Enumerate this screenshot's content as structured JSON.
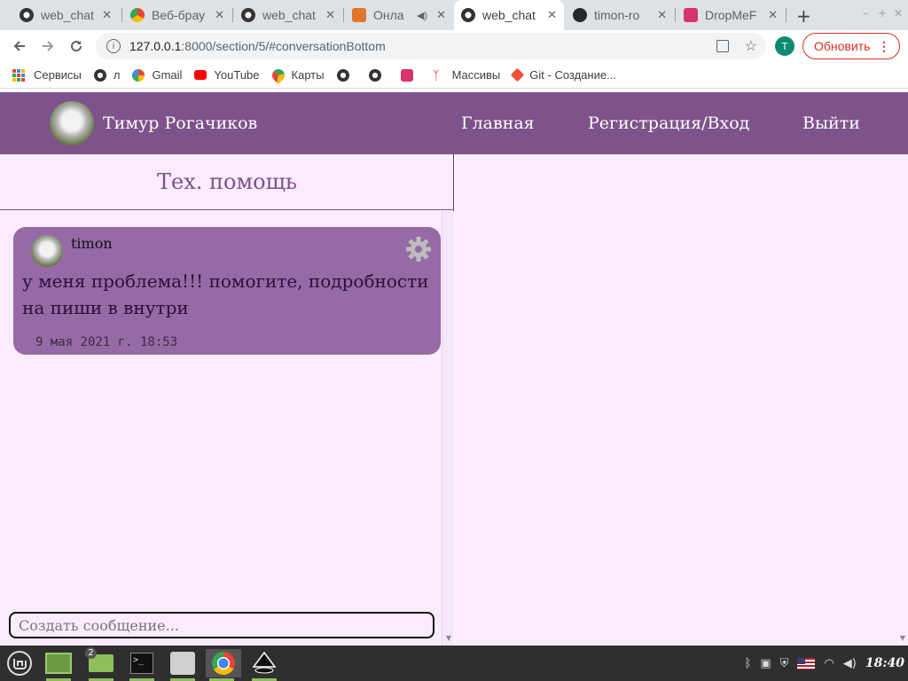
{
  "browser": {
    "tabs": [
      {
        "title": "web_chat",
        "favicon": "globe-icon"
      },
      {
        "title": "Веб-брау",
        "favicon": "chrome-icon"
      },
      {
        "title": "web_chat",
        "favicon": "globe-icon"
      },
      {
        "title": "Онла",
        "favicon": "fox-icon"
      },
      {
        "title": "web_chat",
        "favicon": "globe-icon",
        "active": true
      },
      {
        "title": "timon-ro",
        "favicon": "github-icon"
      },
      {
        "title": "DropMeF",
        "favicon": "dropme-icon"
      }
    ],
    "close_glyph": "✕",
    "new_tab_glyph": "+",
    "window_controls": [
      "–",
      "+",
      "✕"
    ],
    "url_host": "127.0.0.1",
    "url_path": ":8000/section/5/#conversationBottom",
    "profile_initial": "T",
    "update_label": "Обновить",
    "bookmarks": [
      {
        "label": "Сервисы",
        "icon": "apps-grid-icon"
      },
      {
        "label": "л",
        "icon": "globe-icon"
      },
      {
        "label": "Gmail",
        "icon": "google-icon"
      },
      {
        "label": "YouTube",
        "icon": "youtube-icon"
      },
      {
        "label": "Карты",
        "icon": "maps-icon"
      },
      {
        "label": "",
        "icon": "globe-icon"
      },
      {
        "label": "",
        "icon": "globe-icon"
      },
      {
        "label": "",
        "icon": "dropme-icon"
      },
      {
        "label": "Массивы",
        "icon": "antenna-icon"
      },
      {
        "label": "Git - Создание...",
        "icon": "git-icon"
      }
    ]
  },
  "site": {
    "user_name": "Тимур Рогачиков",
    "nav": [
      "Главная",
      "Регистрация/Вход",
      "Выйти"
    ],
    "section_title": "Тех. помощь",
    "messages": [
      {
        "user": "timon",
        "text": "у меня проблема!!! помогите, подробности на пиши в внутри",
        "time": "9 мая 2021 г. 18:53"
      }
    ],
    "compose_placeholder": "Создать сообщение..."
  },
  "taskbar": {
    "workspace_badge": "2",
    "clock": "18:40"
  },
  "colors": {
    "header": "#7e528a",
    "bubble": "#966aa5",
    "panel_bg": "#fbebff",
    "title": "#7e528a"
  }
}
